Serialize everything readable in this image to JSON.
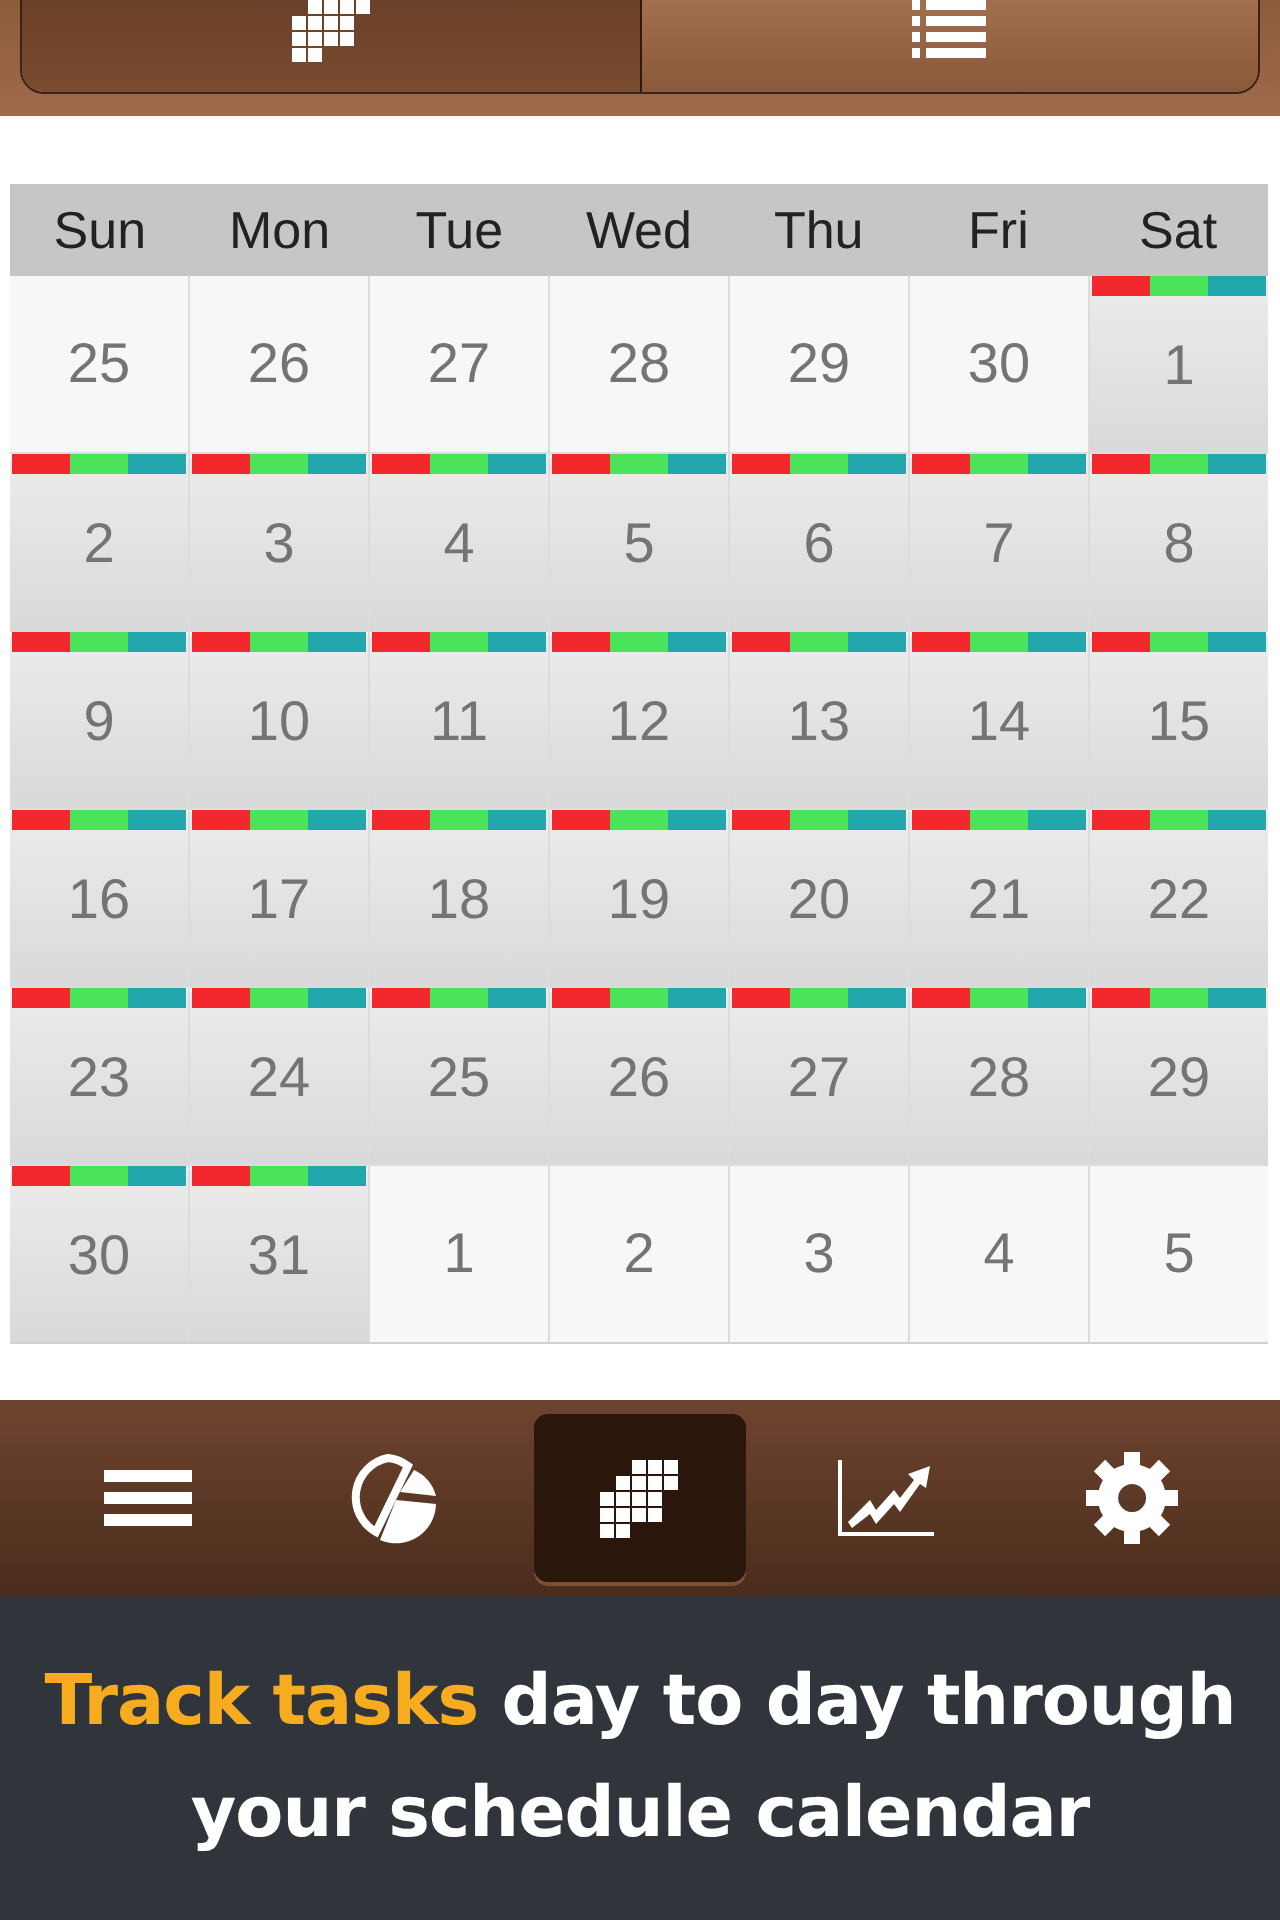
{
  "view_switch": [
    {
      "kind": "grid",
      "selected": true
    },
    {
      "kind": "list",
      "selected": false
    }
  ],
  "weekdays": [
    "Sun",
    "Mon",
    "Tue",
    "Wed",
    "Thu",
    "Fri",
    "Sat"
  ],
  "task_colors": [
    {
      "color": "#f2282d"
    },
    {
      "color": "#4ae35a"
    },
    {
      "color": "#22a7ad"
    }
  ],
  "days": [
    {
      "label": "25",
      "current_month": false,
      "has_tasks": false
    },
    {
      "label": "26",
      "current_month": false,
      "has_tasks": false
    },
    {
      "label": "27",
      "current_month": false,
      "has_tasks": false
    },
    {
      "label": "28",
      "current_month": false,
      "has_tasks": false
    },
    {
      "label": "29",
      "current_month": false,
      "has_tasks": false
    },
    {
      "label": "30",
      "current_month": false,
      "has_tasks": false
    },
    {
      "label": "1",
      "current_month": true,
      "has_tasks": true
    },
    {
      "label": "2",
      "current_month": true,
      "has_tasks": true
    },
    {
      "label": "3",
      "current_month": true,
      "has_tasks": true
    },
    {
      "label": "4",
      "current_month": true,
      "has_tasks": true
    },
    {
      "label": "5",
      "current_month": true,
      "has_tasks": true
    },
    {
      "label": "6",
      "current_month": true,
      "has_tasks": true
    },
    {
      "label": "7",
      "current_month": true,
      "has_tasks": true
    },
    {
      "label": "8",
      "current_month": true,
      "has_tasks": true
    },
    {
      "label": "9",
      "current_month": true,
      "has_tasks": true
    },
    {
      "label": "10",
      "current_month": true,
      "has_tasks": true
    },
    {
      "label": "11",
      "current_month": true,
      "has_tasks": true
    },
    {
      "label": "12",
      "current_month": true,
      "has_tasks": true
    },
    {
      "label": "13",
      "current_month": true,
      "has_tasks": true
    },
    {
      "label": "14",
      "current_month": true,
      "has_tasks": true
    },
    {
      "label": "15",
      "current_month": true,
      "has_tasks": true
    },
    {
      "label": "16",
      "current_month": true,
      "has_tasks": true
    },
    {
      "label": "17",
      "current_month": true,
      "has_tasks": true
    },
    {
      "label": "18",
      "current_month": true,
      "has_tasks": true
    },
    {
      "label": "19",
      "current_month": true,
      "has_tasks": true
    },
    {
      "label": "20",
      "current_month": true,
      "has_tasks": true
    },
    {
      "label": "21",
      "current_month": true,
      "has_tasks": true
    },
    {
      "label": "22",
      "current_month": true,
      "has_tasks": true
    },
    {
      "label": "23",
      "current_month": true,
      "has_tasks": true
    },
    {
      "label": "24",
      "current_month": true,
      "has_tasks": true
    },
    {
      "label": "25",
      "current_month": true,
      "has_tasks": true
    },
    {
      "label": "26",
      "current_month": true,
      "has_tasks": true
    },
    {
      "label": "27",
      "current_month": true,
      "has_tasks": true
    },
    {
      "label": "28",
      "current_month": true,
      "has_tasks": true
    },
    {
      "label": "29",
      "current_month": true,
      "has_tasks": true
    },
    {
      "label": "30",
      "current_month": true,
      "has_tasks": true
    },
    {
      "label": "31",
      "current_month": true,
      "has_tasks": true
    },
    {
      "label": "1",
      "current_month": false,
      "has_tasks": false
    },
    {
      "label": "2",
      "current_month": false,
      "has_tasks": false
    },
    {
      "label": "3",
      "current_month": false,
      "has_tasks": false
    },
    {
      "label": "4",
      "current_month": false,
      "has_tasks": false
    },
    {
      "label": "5",
      "current_month": false,
      "has_tasks": false
    }
  ],
  "tab_bar": [
    {
      "kind": "menu",
      "selected": false
    },
    {
      "kind": "pie",
      "selected": false
    },
    {
      "kind": "grid",
      "selected": true
    },
    {
      "kind": "chart",
      "selected": false
    },
    {
      "kind": "settings",
      "selected": false
    }
  ],
  "caption": "**Track tasks** day to day through your schedule calendar"
}
